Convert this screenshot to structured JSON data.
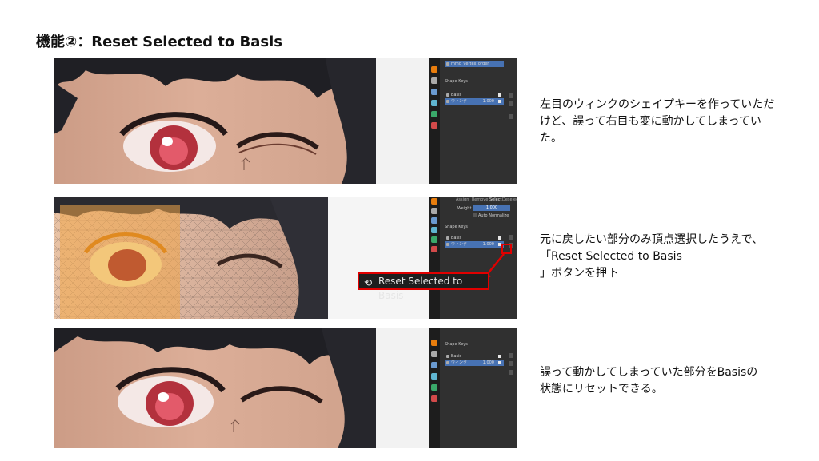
{
  "title": "機能②：Reset Selected to Basis",
  "panel1": {
    "vertex_group_name": "mmd_vertex_order",
    "section_label": "Shape Keys",
    "keys": [
      {
        "name": "Basis",
        "value": ""
      },
      {
        "name": "ウィンク",
        "value": "1.000"
      }
    ]
  },
  "panel2": {
    "tabs": [
      "Assign",
      "Remove",
      "Select",
      "Deselect"
    ],
    "weight_label": "Weight",
    "weight_value": "1.000",
    "auto_normalize_label": "Auto Normalize",
    "section_label": "Shape Keys",
    "keys": [
      {
        "name": "Basis",
        "value": ""
      },
      {
        "name": "ウィンク",
        "value": "1.000"
      }
    ],
    "reset_button_label": "Reset Selected to Basis"
  },
  "panel3": {
    "section_label": "Shape Keys",
    "keys": [
      {
        "name": "Basis",
        "value": ""
      },
      {
        "name": "ウィンク",
        "value": "1.000"
      }
    ]
  },
  "descriptions": [
    "左目のウィンクのシェイプキーを作っていただ\nけど、誤って右目も変に動かしてしまってい\nた。",
    "元に戻したい部分のみ頂点選択したうえで、\n「Reset Selected to Basis\n」ボタンを押下",
    "誤って動かしてしまっていた部分をBasisの\n状態にリセットできる。"
  ],
  "colors": {
    "selection_blue": "#4772b3",
    "highlight_red": "#e00000",
    "panel_bg": "#303030"
  }
}
